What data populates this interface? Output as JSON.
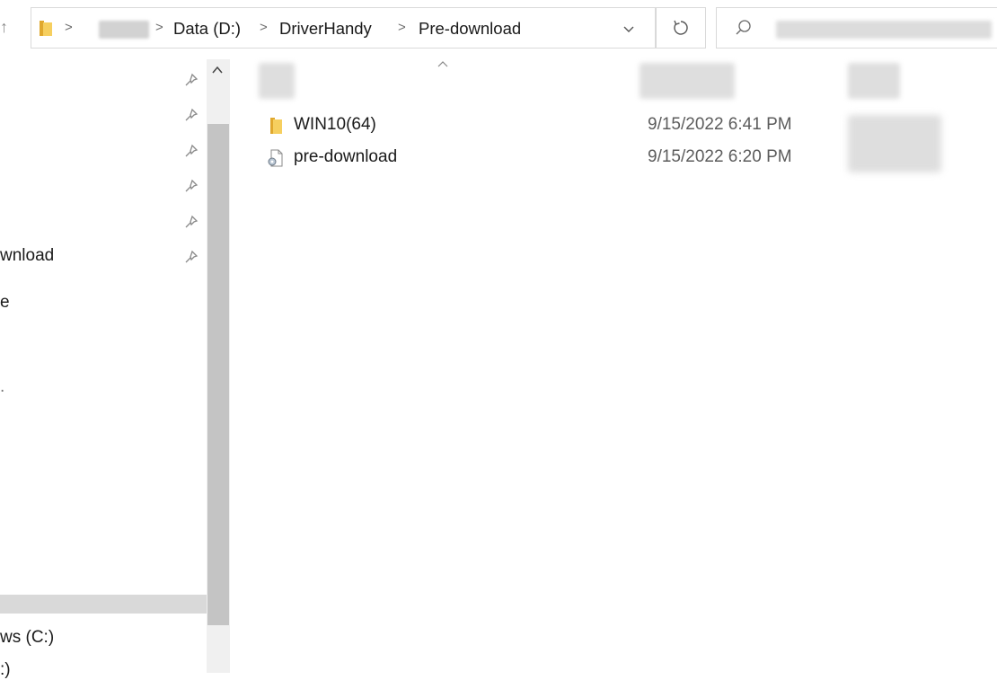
{
  "address_bar": {
    "crumbs": [
      "Data (D:)",
      "DriverHandy",
      "Pre-download"
    ],
    "separator": ">"
  },
  "nav_pane": {
    "items": [
      {
        "label": "wnload",
        "pinned": true
      },
      {
        "label": "e"
      },
      {
        "label": "."
      },
      {
        "label": "ws (C:)"
      },
      {
        "label": ":)"
      }
    ],
    "pin_count": 6,
    "selected_index": 4
  },
  "file_list": {
    "rows": [
      {
        "name": "WIN10(64)",
        "date": "9/15/2022 6:41 PM",
        "type": "folder"
      },
      {
        "name": "pre-download",
        "date": "9/15/2022 6:20 PM",
        "type": "settings-file"
      }
    ]
  },
  "colors": {
    "folder": "#f2c14e",
    "selection": "#d9d9d9",
    "scroll_thumb": "#c4c4c4",
    "border": "#d9d9d9"
  }
}
